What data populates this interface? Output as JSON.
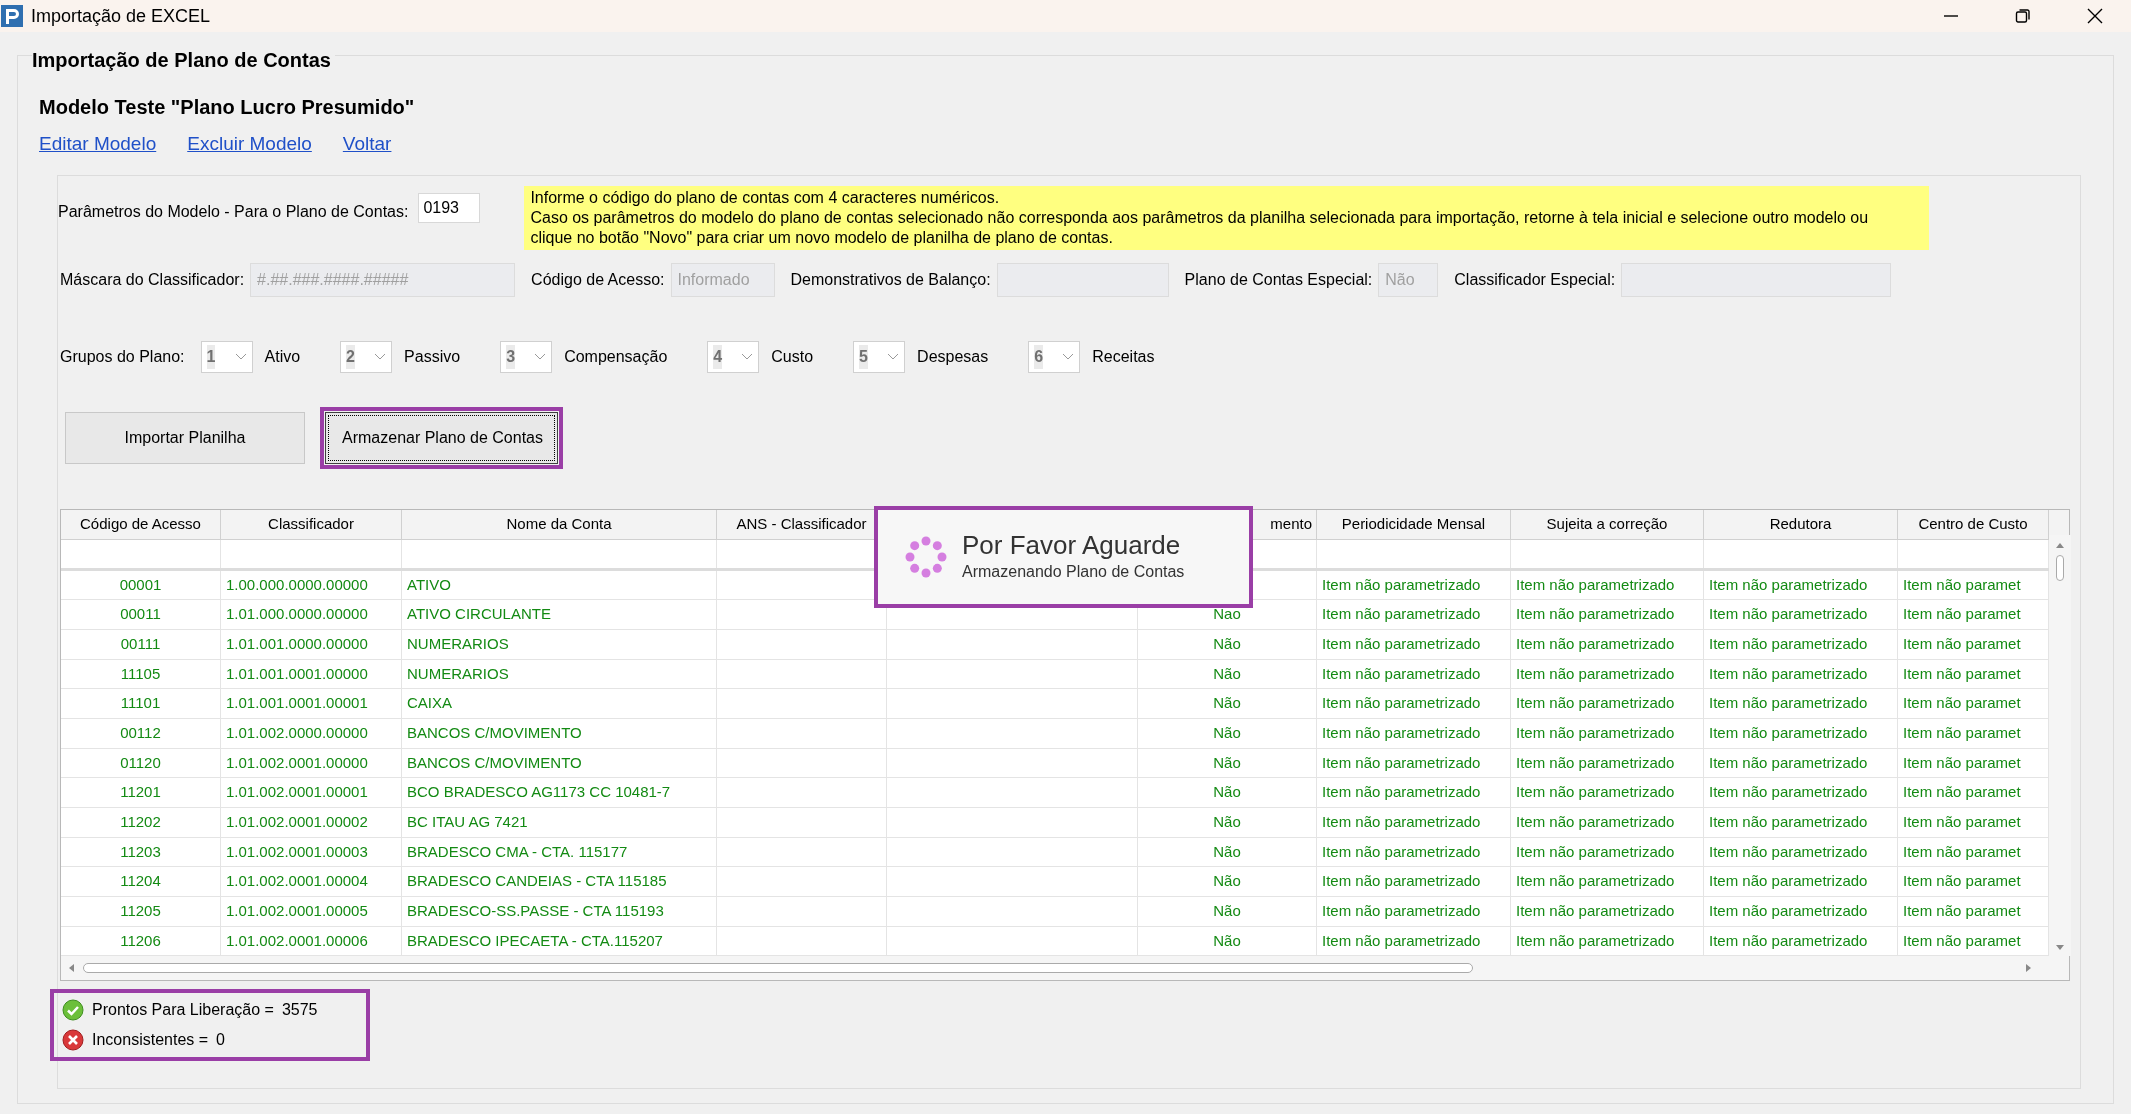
{
  "window": {
    "title": "Importação de EXCEL"
  },
  "group_title": "Importação de Plano de Contas",
  "model_title": "Modelo Teste \"Plano Lucro Presumido\"",
  "links": [
    "Editar Modelo",
    "Excluir Modelo",
    "Voltar"
  ],
  "plan_param": {
    "label": "Parâmetros do Modelo - Para o Plano de Contas:",
    "value": "0193"
  },
  "info_lines": [
    "Informe o código do plano de contas com 4 caracteres numéricos.",
    "Caso os parâmetros do modelo do plano de contas selecionado não corresponda aos parâmetros da planilha selecionada para importação, retorne à tela inicial e selecione outro modelo ou",
    "clique no botão \"Novo\" para criar um novo modelo de planilha de plano de contas."
  ],
  "fields": [
    {
      "label": "Máscara do Classificador:",
      "value": "#.##.###.####.#####"
    },
    {
      "label": "Código de Acesso:",
      "value": "Informado"
    },
    {
      "label": "Demonstrativos de Balanço:"
    },
    {
      "label": "Plano de Contas Especial:",
      "value": "Não"
    },
    {
      "label": "Classificador Especial:"
    }
  ],
  "groups_label": "Grupos do Plano:",
  "groups": [
    {
      "number": "1",
      "label": "Ativo"
    },
    {
      "number": "2",
      "label": "Passivo"
    },
    {
      "number": "3",
      "label": "Compensação"
    },
    {
      "number": "4",
      "label": "Custo"
    },
    {
      "number": "5",
      "label": "Despesas"
    },
    {
      "number": "6",
      "label": "Receitas"
    }
  ],
  "buttons": [
    {
      "label": "Importar Planilha",
      "highlighted": false
    },
    {
      "label": "Armazenar Plano de Contas",
      "highlighted": true
    }
  ],
  "table": {
    "columns": [
      {
        "label": "Código de Acesso"
      },
      {
        "label": "Classificador"
      },
      {
        "label": "Nome da Conta"
      },
      {
        "label": "ANS - Classificador"
      },
      {},
      {
        "label": "mento"
      },
      {
        "label": "Periodicidade Mensal"
      },
      {
        "label": "Sujeita a correção"
      },
      {
        "label": "Redutora"
      },
      {
        "label": "Centro de Custo"
      }
    ],
    "rows": [
      {
        "cells": [
          "00001",
          "1.00.000.0000.00000",
          "ATIVO",
          null,
          null,
          null,
          "Item não parametrizado",
          "Item não parametrizado",
          "Item não parametrizado",
          "Item não paramet"
        ]
      },
      {
        "cells": [
          "00011",
          "1.01.000.0000.00000",
          "ATIVO CIRCULANTE",
          null,
          null,
          "Nao",
          "Item não parametrizado",
          "Item não parametrizado",
          "Item não parametrizado",
          "Item não paramet"
        ]
      },
      {
        "cells": [
          "00111",
          "1.01.001.0000.00000",
          "NUMERARIOS",
          null,
          null,
          "Não",
          "Item não parametrizado",
          "Item não parametrizado",
          "Item não parametrizado",
          "Item não paramet"
        ]
      },
      {
        "cells": [
          "11105",
          "1.01.001.0001.00000",
          "NUMERARIOS",
          null,
          null,
          "Não",
          "Item não parametrizado",
          "Item não parametrizado",
          "Item não parametrizado",
          "Item não paramet"
        ]
      },
      {
        "cells": [
          "11101",
          "1.01.001.0001.00001",
          "CAIXA",
          null,
          null,
          "Não",
          "Item não parametrizado",
          "Item não parametrizado",
          "Item não parametrizado",
          "Item não paramet"
        ]
      },
      {
        "cells": [
          "00112",
          "1.01.002.0000.00000",
          "BANCOS C/MOVIMENTO",
          null,
          null,
          "Não",
          "Item não parametrizado",
          "Item não parametrizado",
          "Item não parametrizado",
          "Item não paramet"
        ]
      },
      {
        "cells": [
          "01120",
          "1.01.002.0001.00000",
          "BANCOS C/MOVIMENTO",
          null,
          null,
          "Não",
          "Item não parametrizado",
          "Item não parametrizado",
          "Item não parametrizado",
          "Item não paramet"
        ]
      },
      {
        "cells": [
          "11201",
          "1.01.002.0001.00001",
          "BCO BRADESCO AG1173 CC 10481-7",
          null,
          null,
          "Não",
          "Item não parametrizado",
          "Item não parametrizado",
          "Item não parametrizado",
          "Item não paramet"
        ]
      },
      {
        "cells": [
          "11202",
          "1.01.002.0001.00002",
          "BC ITAU AG 7421",
          null,
          null,
          "Não",
          "Item não parametrizado",
          "Item não parametrizado",
          "Item não parametrizado",
          "Item não paramet"
        ]
      },
      {
        "cells": [
          "11203",
          "1.01.002.0001.00003",
          "BRADESCO CMA - CTA. 115177",
          null,
          null,
          "Não",
          "Item não parametrizado",
          "Item não parametrizado",
          "Item não parametrizado",
          "Item não paramet"
        ]
      },
      {
        "cells": [
          "11204",
          "1.01.002.0001.00004",
          "BRADESCO CANDEIAS - CTA 115185",
          null,
          null,
          "Não",
          "Item não parametrizado",
          "Item não parametrizado",
          "Item não parametrizado",
          "Item não paramet"
        ]
      },
      {
        "cells": [
          "11205",
          "1.01.002.0001.00005",
          "BRADESCO-SS.PASSE - CTA 115193",
          null,
          null,
          "Não",
          "Item não parametrizado",
          "Item não parametrizado",
          "Item não parametrizado",
          "Item não paramet"
        ]
      },
      {
        "cells": [
          "11206",
          "1.01.002.0001.00006",
          "BRADESCO IPECAETA - CTA.115207",
          null,
          null,
          "Não",
          "Item não parametrizado",
          "Item não parametrizado",
          "Item não parametrizado",
          "Item não paramet"
        ]
      }
    ]
  },
  "wait_popup": {
    "title": "Por Favor Aguarde",
    "subtitle": "Armazenando Plano de Contas"
  },
  "status": {
    "highlighted": true,
    "items": [
      {
        "kind": "ok",
        "text": "Prontos Para Liberação =",
        "count": "3575"
      },
      {
        "kind": "error",
        "text": "Inconsistentes =",
        "count": "0"
      }
    ]
  }
}
